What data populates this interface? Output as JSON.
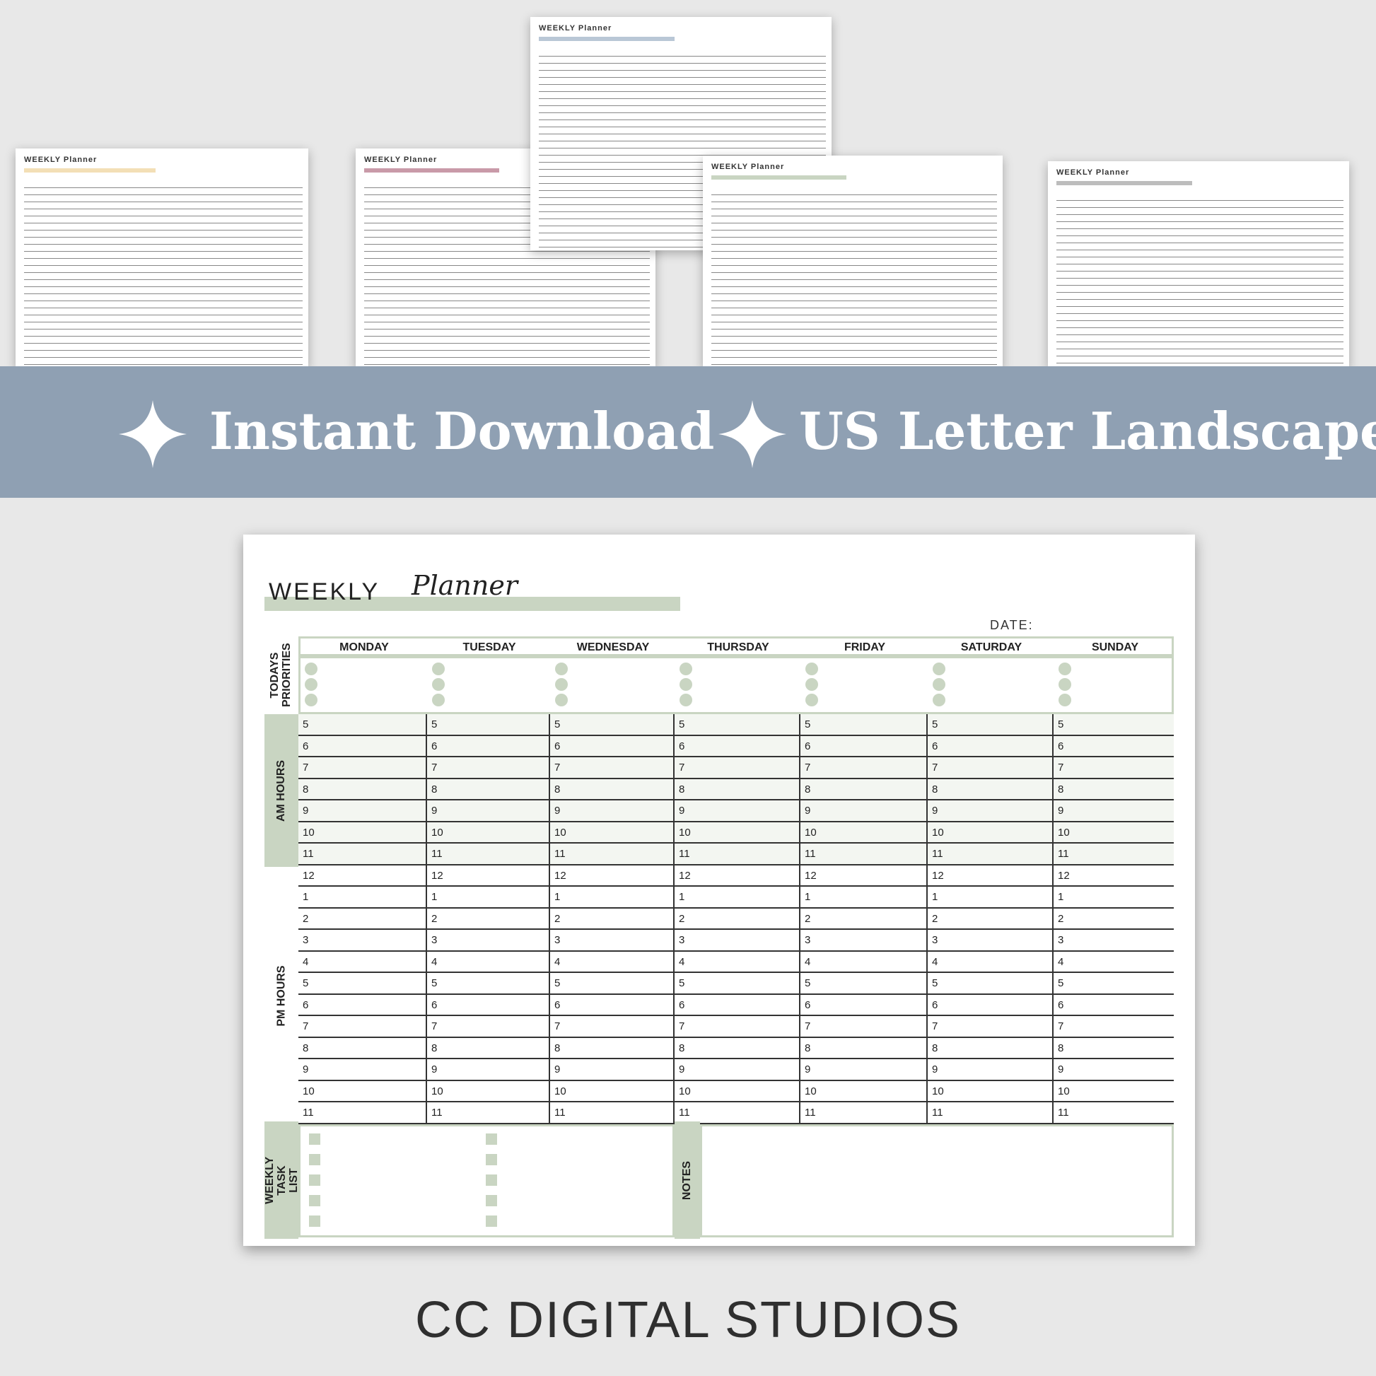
{
  "banner": {
    "items": [
      "Instant Download",
      "US Letter Landscape"
    ],
    "color": "#8fa0b3"
  },
  "planner": {
    "title_main": "WEEKLY",
    "title_script": "Planner",
    "date_label": "DATE:",
    "accent_color": "#c9d5c2",
    "priorities_label": "TODAYS PRIORITIES",
    "am_label": "AM HOURS",
    "pm_label": "PM HOURS",
    "task_label": "WEEKLY TASK LIST",
    "notes_label": "NOTES",
    "days": [
      "MONDAY",
      "TUESDAY",
      "WEDNESDAY",
      "THURSDAY",
      "FRIDAY",
      "SATURDAY",
      "SUNDAY"
    ],
    "am_hours": [
      "5",
      "6",
      "7",
      "8",
      "9",
      "10",
      "11"
    ],
    "pm_hours": [
      "12",
      "1",
      "2",
      "3",
      "4",
      "5",
      "6",
      "7",
      "8",
      "9",
      "10",
      "11"
    ]
  },
  "previews": [
    {
      "title": "WEEKLY Planner",
      "accent": "#f3dfb6"
    },
    {
      "title": "WEEKLY Planner",
      "accent": "#c99aa8"
    },
    {
      "title": "WEEKLY Planner",
      "accent": "#b9c7d6"
    },
    {
      "title": "WEEKLY Planner",
      "accent": "#c9d5c2"
    },
    {
      "title": "WEEKLY Planner",
      "accent": "#bdbdbd"
    }
  ],
  "footer": {
    "brand": "CC DIGITAL STUDIOS"
  }
}
